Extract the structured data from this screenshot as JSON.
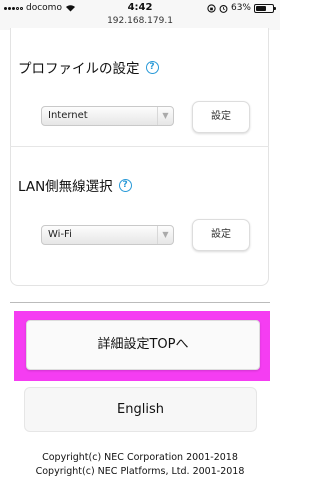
{
  "status_bar": {
    "carrier": "docomo",
    "time": "4:42",
    "battery": "63%",
    "battery_level": 0.63
  },
  "browser": {
    "url": "192.168.179.1"
  },
  "profile_section": {
    "title": "プロファイルの設定",
    "help": "?",
    "selected": "Internet",
    "button": "設定"
  },
  "lan_section": {
    "title": "LAN側無線選択",
    "help": "?",
    "selected": "Wi-Fi",
    "button": "設定"
  },
  "nav": {
    "top_button": "詳細設定TOPへ",
    "english_button": "English",
    "highlight_color": "#f53df2"
  },
  "footer": {
    "copyright_1": "Copyright(c) NEC Corporation 2001-2018",
    "copyright_2": "Copyright(c) NEC Platforms, Ltd. 2001-2018"
  }
}
